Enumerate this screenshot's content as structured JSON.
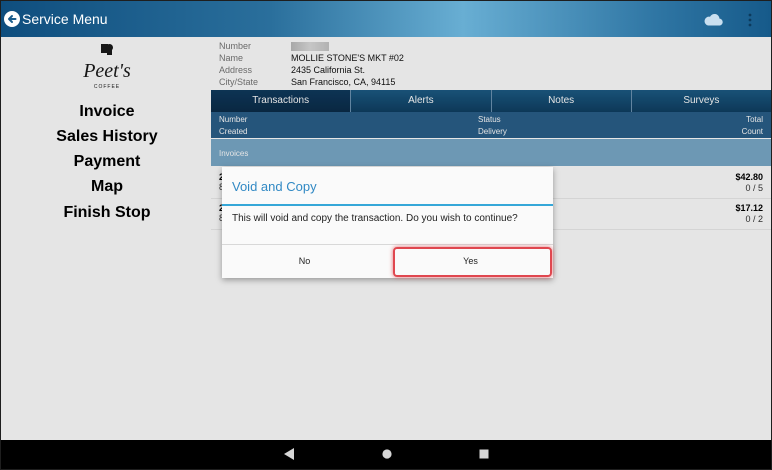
{
  "header": {
    "title": "Service Menu"
  },
  "sidebar": {
    "logo_text": "Peet's",
    "logo_sub": "COFFEE",
    "items": [
      "Invoice",
      "Sales History",
      "Payment",
      "Map",
      "Finish Stop"
    ]
  },
  "customer": {
    "number_label": "Number",
    "number_value": "",
    "name_label": "Name",
    "name_value": "MOLLIE STONE'S MKT #02",
    "address_label": "Address",
    "address_value": "2435 California St.",
    "city_label": "City/State",
    "city_value": "San Francisco, CA, 94115"
  },
  "tabs": [
    "Transactions",
    "Alerts",
    "Notes",
    "Surveys"
  ],
  "columns": {
    "col1a": "Number",
    "col1b": "Created",
    "col2a": "Status",
    "col2b": "Delivery",
    "col3a": "Total",
    "col3b": "Count"
  },
  "section": "Invoices",
  "invoices": [
    {
      "number": "2",
      "sub": "8",
      "total": "$42.80",
      "count": "0 / 5"
    },
    {
      "number": "2",
      "sub": "8",
      "total": "$17.12",
      "count": "0 / 2"
    }
  ],
  "dialog": {
    "title": "Void and Copy",
    "message": "This will void and copy the transaction.  Do you wish to continue?",
    "no": "No",
    "yes": "Yes"
  },
  "colors": {
    "accent": "#3189c4",
    "tab_bg": "#1c5b85",
    "highlight": "#e0474f"
  }
}
